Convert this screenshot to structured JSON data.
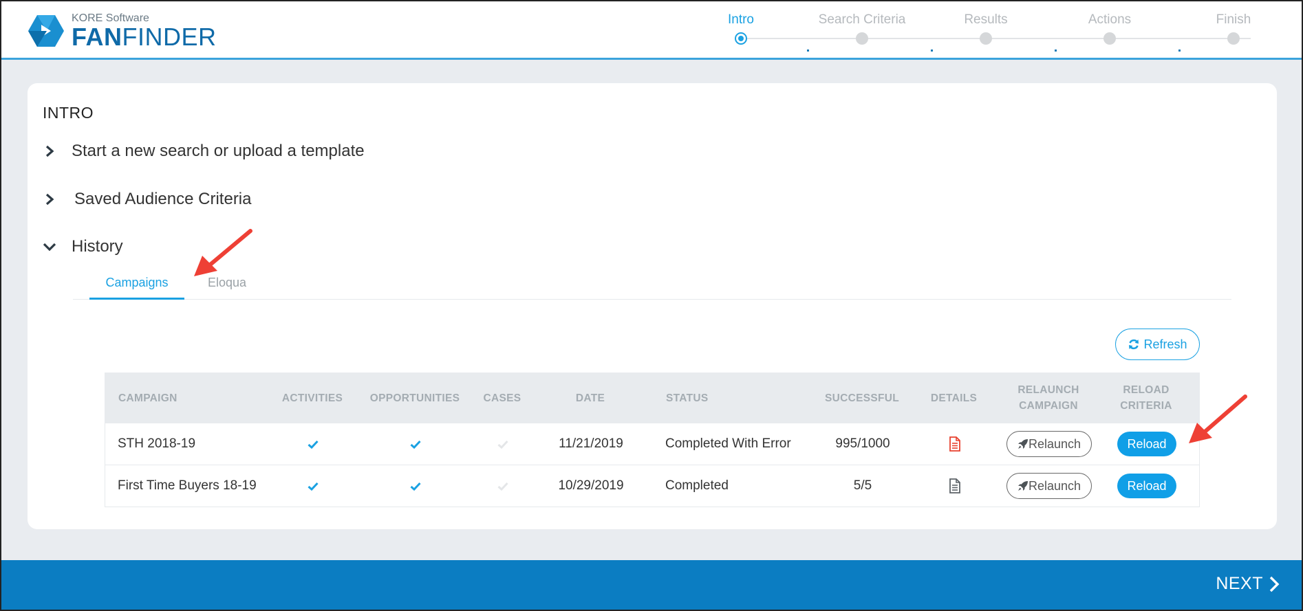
{
  "header": {
    "company": "KORE Software",
    "product_bold": "FAN",
    "product_rest": "FINDER",
    "steps": [
      {
        "label": "Intro",
        "state": "active"
      },
      {
        "label": "Search Criteria",
        "state": "inactive"
      },
      {
        "label": "Results",
        "state": "inactive"
      },
      {
        "label": "Actions",
        "state": "inactive"
      },
      {
        "label": "Finish",
        "state": "inactive"
      }
    ]
  },
  "intro": {
    "title": "INTRO",
    "accordion": [
      {
        "label": "Start a new search or upload a template",
        "expanded": false
      },
      {
        "label": "Saved Audience Criteria",
        "expanded": false
      },
      {
        "label": "History",
        "expanded": true
      }
    ]
  },
  "history": {
    "tabs": [
      {
        "label": "Campaigns",
        "active": true
      },
      {
        "label": "Eloqua",
        "active": false
      }
    ],
    "refresh_label": "Refresh",
    "columns": [
      "CAMPAIGN",
      "ACTIVITIES",
      "OPPORTUNITIES",
      "CASES",
      "DATE",
      "STATUS",
      "SUCCESSFUL",
      "DETAILS",
      "RELAUNCH CAMPAIGN",
      "RELOAD CRITERIA"
    ],
    "rows": [
      {
        "campaign": "STH 2018-19",
        "activities": true,
        "opportunities": true,
        "cases": false,
        "date": "11/21/2019",
        "status": "Completed With Error",
        "successful": "995/1000",
        "details_icon": "document-error-icon",
        "relaunch_label": "Relaunch",
        "reload_label": "Reload"
      },
      {
        "campaign": "First Time Buyers 18-19",
        "activities": true,
        "opportunities": true,
        "cases": false,
        "date": "10/29/2019",
        "status": "Completed",
        "successful": "5/5",
        "details_icon": "document-icon",
        "relaunch_label": "Relaunch",
        "reload_label": "Reload"
      }
    ]
  },
  "footer": {
    "next_label": "NEXT"
  },
  "colors": {
    "accent": "#1aa1e2",
    "footer": "#0b7dc2",
    "error": "#e8412f",
    "annotation_arrow": "#ee4035"
  }
}
